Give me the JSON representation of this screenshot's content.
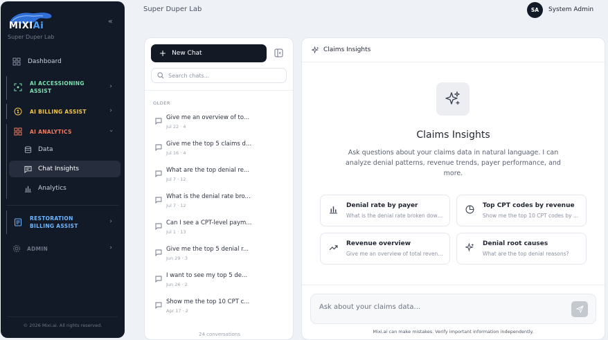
{
  "app": {
    "logo_text_main": "MIXI",
    "logo_text_accent": "Ai",
    "org_name": "Super Duper Lab"
  },
  "sidebar": {
    "collapse_icon": "double-chevron-left-icon",
    "dashboard_label": "Dashboard",
    "accessioning_label": "AI ACCESSIONING ASSIST",
    "billing_label": "AI BILLING ASSIST",
    "analytics_label": "AI ANALYTICS",
    "analytics_items": [
      {
        "label": "Data",
        "icon": "database-icon"
      },
      {
        "label": "Chat Insights",
        "icon": "chat-icon",
        "active": true
      },
      {
        "label": "Analytics",
        "icon": "bar-chart-icon"
      }
    ],
    "restoration_label": "RESTORATION BILLING ASSIST",
    "admin_label": "ADMIN",
    "footer": "© 2026 Mixi.ai. All rights reserved.",
    "colors": {
      "accessioning": "#7ee0b0",
      "billing": "#f3c64b",
      "analytics": "#f07a5e",
      "restoration": "#6fb6ff"
    }
  },
  "header": {
    "lab_name": "Super Duper Lab",
    "avatar_initials": "SA",
    "user_name": "System Admin"
  },
  "chat_list": {
    "new_chat_label": "New Chat",
    "search_placeholder": "Search chats...",
    "group_label": "OLDER",
    "items": [
      {
        "title": "Give me an overview of to...",
        "meta": "Jul 22  ·  4"
      },
      {
        "title": "Give me the top 5 claims d...",
        "meta": "Jul 16  ·  4"
      },
      {
        "title": "What are the top denial re...",
        "meta": "Jul 7  ·  12"
      },
      {
        "title": "What is the denial rate bro...",
        "meta": "Jul 7  ·  12"
      },
      {
        "title": "Can I see a CPT-level paym...",
        "meta": "Jul 1  ·  13"
      },
      {
        "title": "Give me the top 5 denial r...",
        "meta": "Jun 29  ·  3"
      },
      {
        "title": "I want to see my top 5 de...",
        "meta": "Jun 26  ·  2"
      },
      {
        "title": "Show me the top 10 CPT c...",
        "meta": "Apr 17  ·  2"
      }
    ],
    "conversations_count": "24 conversations"
  },
  "main": {
    "header_title": "Claims Insights",
    "hero_title": "Claims Insights",
    "hero_description": "Ask questions about your claims data in natural language. I can analyze denial patterns, revenue trends, payer performance, and more.",
    "cards": [
      {
        "title": "Denial rate by payer",
        "desc": "What is the denial rate broken down by payer?",
        "icon": "bar-chart-icon"
      },
      {
        "title": "Top CPT codes by revenue",
        "desc": "Show me the top 10 CPT codes by revenue",
        "icon": "pie-chart-icon"
      },
      {
        "title": "Revenue overview",
        "desc": "Give me an overview of total revenue",
        "icon": "trending-up-icon"
      },
      {
        "title": "Denial root causes",
        "desc": "What are the top denial reasons?",
        "icon": "sparkles-icon"
      }
    ],
    "input_placeholder": "Ask about your claims data...",
    "disclaimer": "Mixi.ai can make mistakes. Verify important information independently."
  }
}
